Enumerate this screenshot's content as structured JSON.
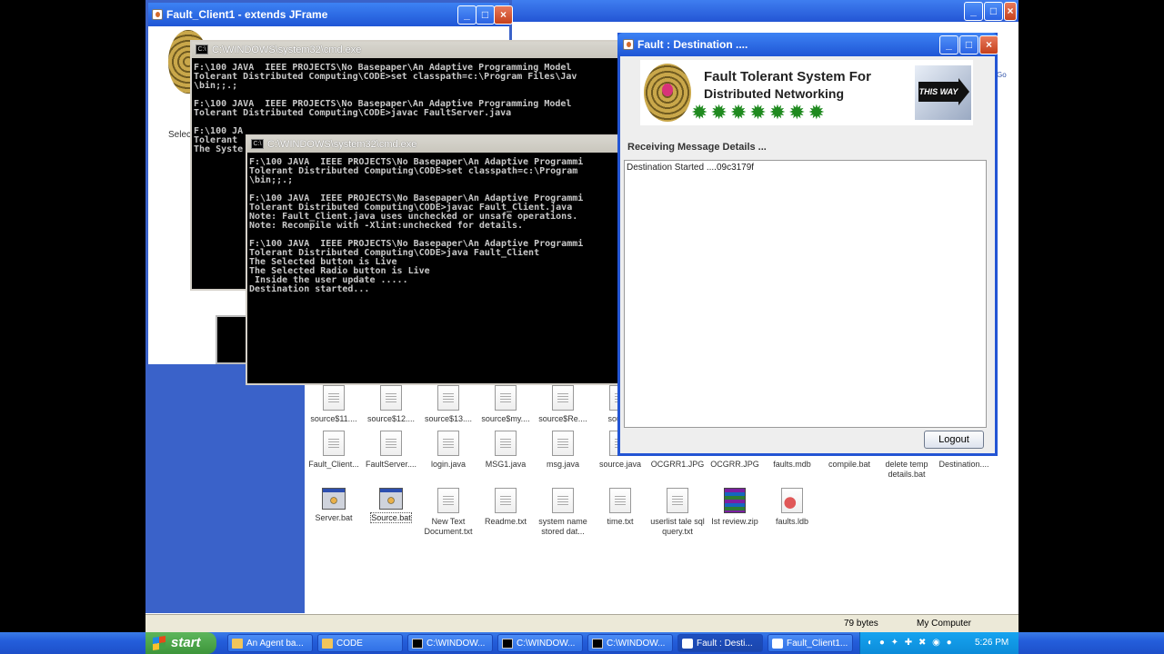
{
  "client_window": {
    "title": "Fault_Client1 - extends JFrame",
    "partial_label": "Selec"
  },
  "cmd_back": {
    "title": "C:\\WINDOWS\\system32\\cmd.exe",
    "text": "F:\\100 JAVA  IEEE PROJECTS\\No Basepaper\\An Adaptive Programming Model\nTolerant Distributed Computing\\CODE>set classpath=c:\\Program Files\\Jav\n\\bin;;.;\n\nF:\\100 JAVA  IEEE PROJECTS\\No Basepaper\\An Adaptive Programming Model\nTolerant Distributed Computing\\CODE>javac FaultServer.java\n\nF:\\100 JA\nTolerant\nThe Syste"
  },
  "cmd_front": {
    "title": "C:\\WINDOWS\\system32\\cmd.exe",
    "text": "F:\\100 JAVA  IEEE PROJECTS\\No Basepaper\\An Adaptive Programmi\nTolerant Distributed Computing\\CODE>set classpath=c:\\Program\n\\bin;;.;\n\nF:\\100 JAVA  IEEE PROJECTS\\No Basepaper\\An Adaptive Programmi\nTolerant Distributed Computing\\CODE>javac Fault_Client.java\nNote: Fault_Client.java uses unchecked or unsafe operations.\nNote: Recompile with -Xlint:unchecked for details.\n\nF:\\100 JAVA  IEEE PROJECTS\\No Basepaper\\An Adaptive Programmi\nTolerant Distributed Computing\\CODE>java Fault_Client\nThe Selected button is Live\nThe Selected Radio button is Live\n Inside the user update .....\nDestination started..."
  },
  "dest_window": {
    "title": "Fault : Destination ....",
    "banner_line1": "Fault Tolerant  System For",
    "banner_line2": "Distributed Networking",
    "banner_sign": "THIS WAY",
    "stars": "✹✹✹✹✹✹✹",
    "receiving_label": "Receiving Message Details ...",
    "message": "Destination Started ....09c3179f",
    "logout_label": "Logout"
  },
  "files": [
    {
      "name": "source$11....",
      "kind": "doc"
    },
    {
      "name": "source$12....",
      "kind": "doc"
    },
    {
      "name": "source$13....",
      "kind": "doc"
    },
    {
      "name": "source$my....",
      "kind": "doc"
    },
    {
      "name": "source$Re....",
      "kind": "doc"
    },
    {
      "name": "source",
      "kind": "doc"
    },
    {
      "name": "Fault_Client...",
      "kind": "doc"
    },
    {
      "name": "FaultServer....",
      "kind": "doc"
    },
    {
      "name": "login.java",
      "kind": "doc"
    },
    {
      "name": "MSG1.java",
      "kind": "doc"
    },
    {
      "name": "msg.java",
      "kind": "doc"
    },
    {
      "name": "source.java",
      "kind": "doc"
    },
    {
      "name": "OCGRR1.JPG",
      "kind": "doc"
    },
    {
      "name": "OCGRR.JPG",
      "kind": "doc"
    },
    {
      "name": "faults.mdb",
      "kind": "doc"
    },
    {
      "name": "compile.bat",
      "kind": "doc"
    },
    {
      "name": "delete temp details.bat",
      "kind": "doc"
    },
    {
      "name": "Destination....",
      "kind": "doc"
    },
    {
      "name": "Server.bat",
      "kind": "bat"
    },
    {
      "name": "Source.bat",
      "kind": "bat"
    },
    {
      "name": "New Text Document.txt",
      "kind": "doc"
    },
    {
      "name": "Readme.txt",
      "kind": "doc"
    },
    {
      "name": "system name stored dat...",
      "kind": "doc"
    },
    {
      "name": "time.txt",
      "kind": "doc"
    },
    {
      "name": "userlist tale sql query.txt",
      "kind": "doc"
    },
    {
      "name": "Ist review.zip",
      "kind": "zip"
    },
    {
      "name": "faults.ldb",
      "kind": "ldb"
    }
  ],
  "statusbar": {
    "size": "79 bytes",
    "location": "My Computer",
    "partial_go": "Go"
  },
  "taskbar": {
    "start_label": "start",
    "tasks": [
      {
        "label": "An Agent ba...",
        "icon": "folder"
      },
      {
        "label": "CODE",
        "icon": "folder"
      },
      {
        "label": "C:\\WINDOW...",
        "icon": "console"
      },
      {
        "label": "C:\\WINDOW...",
        "icon": "console"
      },
      {
        "label": "C:\\WINDOW...",
        "icon": "console"
      },
      {
        "label": "Fault : Desti...",
        "icon": "java"
      },
      {
        "label": "Fault_Client1...",
        "icon": "java"
      }
    ],
    "clock": "5:26 PM"
  },
  "icons": {
    "minimize": "minimize-icon",
    "maximize": "maximize-icon",
    "close": "close-icon"
  }
}
